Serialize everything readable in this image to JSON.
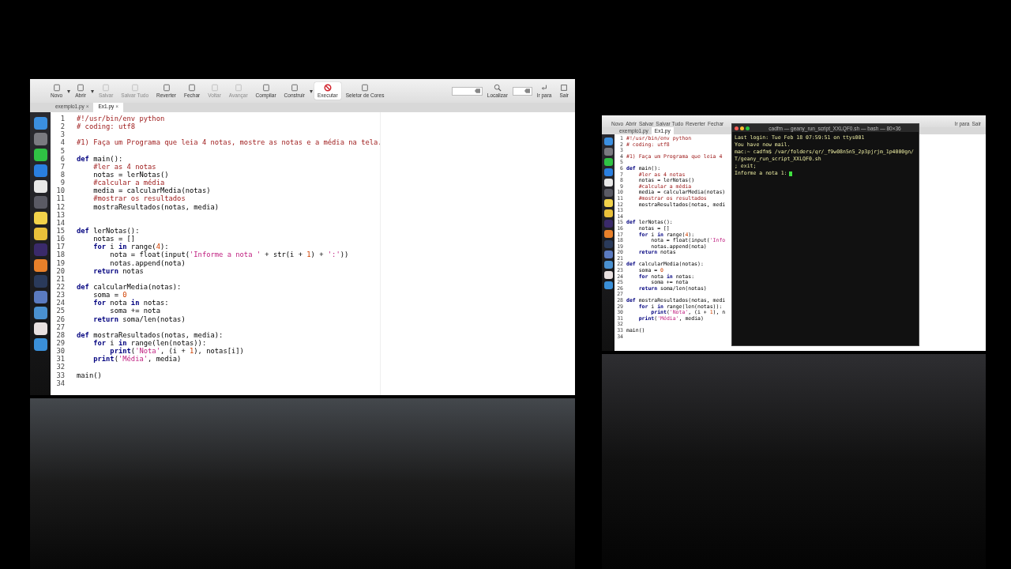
{
  "editor": {
    "toolbar": [
      {
        "label": "Novo",
        "disabled": false,
        "pressed": false,
        "caret": "▾"
      },
      {
        "label": "Abrir",
        "disabled": false,
        "pressed": false,
        "caret": "▾"
      },
      {
        "label": "Salvar",
        "disabled": true,
        "pressed": false
      },
      {
        "label": "Salvar Tudo",
        "disabled": true,
        "pressed": false
      },
      {
        "label": "Reverter",
        "disabled": false,
        "pressed": false
      },
      {
        "label": "Fechar",
        "disabled": false,
        "pressed": false
      },
      {
        "label": "Voltar",
        "disabled": true,
        "pressed": false
      },
      {
        "label": "Avançar",
        "disabled": true,
        "pressed": false
      },
      {
        "label": "Compilar",
        "disabled": false,
        "pressed": false
      },
      {
        "label": "Construir",
        "disabled": false,
        "pressed": false,
        "caret": "▾"
      },
      {
        "label": "Executar",
        "disabled": false,
        "pressed": true
      },
      {
        "label": "Seletor de Cores",
        "disabled": false,
        "pressed": false
      }
    ],
    "search_button": "Localizar",
    "goto_button": "Ir para",
    "quit_button": "Sair",
    "tabs": [
      {
        "label": "exemplo1.py",
        "selected": false
      },
      {
        "label": "Ex1.py",
        "selected": true
      }
    ],
    "close_mark": "×",
    "lines": [
      {
        "n": "1",
        "parts": [
          {
            "kind": "comment",
            "text": "#!/usr/bin/env python"
          }
        ]
      },
      {
        "n": "2",
        "parts": [
          {
            "kind": "comment",
            "text": "# coding: utf8"
          }
        ]
      },
      {
        "n": "3"
      },
      {
        "n": "4",
        "parts": [
          {
            "kind": "comment",
            "text": "#1) Faça um Programa que leia 4 notas, mostre as notas e a média na tela."
          }
        ]
      },
      {
        "n": "5"
      },
      {
        "n": "6",
        "parts": [
          {
            "kind": "keyword",
            "text": "def"
          },
          {
            "kind": "plain",
            "text": " main():"
          }
        ]
      },
      {
        "n": "7",
        "parts": [
          {
            "kind": "comment",
            "text": "    #ler as 4 notas"
          }
        ]
      },
      {
        "n": "8",
        "parts": [
          {
            "kind": "plain",
            "text": "    notas = lerNotas()"
          }
        ]
      },
      {
        "n": "9",
        "parts": [
          {
            "kind": "comment",
            "text": "    #calcular a média"
          }
        ]
      },
      {
        "n": "10",
        "parts": [
          {
            "kind": "plain",
            "text": "    media = calcularMedia(notas)"
          }
        ]
      },
      {
        "n": "11",
        "parts": [
          {
            "kind": "comment",
            "text": "    #mostrar os resultados"
          }
        ]
      },
      {
        "n": "12",
        "parts": [
          {
            "kind": "plain",
            "text": "    mostraResultados(notas, media)"
          }
        ]
      },
      {
        "n": "13"
      },
      {
        "n": "14"
      },
      {
        "n": "15",
        "parts": [
          {
            "kind": "keyword",
            "text": "def"
          },
          {
            "kind": "plain",
            "text": " lerNotas():"
          }
        ]
      },
      {
        "n": "16",
        "parts": [
          {
            "kind": "plain",
            "text": "    notas = []"
          }
        ]
      },
      {
        "n": "17",
        "parts": [
          {
            "kind": "keyword",
            "text": "    for"
          },
          {
            "kind": "plain",
            "text": " i "
          },
          {
            "kind": "keyword",
            "text": "in"
          },
          {
            "kind": "plain",
            "text": " range("
          },
          {
            "kind": "number",
            "text": "4"
          },
          {
            "kind": "plain",
            "text": "):"
          }
        ]
      },
      {
        "n": "18",
        "parts": [
          {
            "kind": "plain",
            "text": "        nota = float(input("
          },
          {
            "kind": "string",
            "text": "'Informe a nota '"
          },
          {
            "kind": "plain",
            "text": " + str(i + "
          },
          {
            "kind": "number",
            "text": "1"
          },
          {
            "kind": "plain",
            "text": ") + "
          },
          {
            "kind": "string",
            "text": "':'"
          },
          {
            "kind": "plain",
            "text": "))"
          }
        ]
      },
      {
        "n": "19",
        "parts": [
          {
            "kind": "plain",
            "text": "        notas.append(nota)"
          }
        ]
      },
      {
        "n": "20",
        "parts": [
          {
            "kind": "keyword",
            "text": "    return"
          },
          {
            "kind": "plain",
            "text": " notas"
          }
        ]
      },
      {
        "n": "21"
      },
      {
        "n": "22",
        "parts": [
          {
            "kind": "keyword",
            "text": "def"
          },
          {
            "kind": "plain",
            "text": " calcularMedia(notas):"
          }
        ]
      },
      {
        "n": "23",
        "parts": [
          {
            "kind": "plain",
            "text": "    soma = "
          },
          {
            "kind": "number",
            "text": "0"
          }
        ]
      },
      {
        "n": "24",
        "parts": [
          {
            "kind": "keyword",
            "text": "    for"
          },
          {
            "kind": "plain",
            "text": " nota "
          },
          {
            "kind": "keyword",
            "text": "in"
          },
          {
            "kind": "plain",
            "text": " notas:"
          }
        ]
      },
      {
        "n": "25",
        "parts": [
          {
            "kind": "plain",
            "text": "        soma += nota"
          }
        ]
      },
      {
        "n": "26",
        "parts": [
          {
            "kind": "keyword",
            "text": "    return"
          },
          {
            "kind": "plain",
            "text": " soma/len(notas)"
          }
        ]
      },
      {
        "n": "27"
      },
      {
        "n": "28",
        "parts": [
          {
            "kind": "keyword",
            "text": "def"
          },
          {
            "kind": "plain",
            "text": " mostraResultados(notas, media):"
          }
        ]
      },
      {
        "n": "29",
        "parts": [
          {
            "kind": "keyword",
            "text": "    for"
          },
          {
            "kind": "plain",
            "text": " i "
          },
          {
            "kind": "keyword",
            "text": "in"
          },
          {
            "kind": "plain",
            "text": " range(len(notas)):"
          }
        ]
      },
      {
        "n": "30",
        "parts": [
          {
            "kind": "keyword",
            "text": "        print"
          },
          {
            "kind": "plain",
            "text": "("
          },
          {
            "kind": "string",
            "text": "'Nota'"
          },
          {
            "kind": "plain",
            "text": ", (i + "
          },
          {
            "kind": "number",
            "text": "1"
          },
          {
            "kind": "plain",
            "text": "), notas[i])"
          }
        ]
      },
      {
        "n": "31",
        "parts": [
          {
            "kind": "keyword",
            "text": "    print"
          },
          {
            "kind": "plain",
            "text": "("
          },
          {
            "kind": "string",
            "text": "'Média'"
          },
          {
            "kind": "plain",
            "text": ", media)"
          }
        ]
      },
      {
        "n": "32"
      },
      {
        "n": "33",
        "parts": [
          {
            "kind": "plain",
            "text": "main()"
          }
        ]
      },
      {
        "n": "34"
      }
    ]
  },
  "second_desktop": {
    "toolbar": [
      "Novo",
      "Abrir",
      "Salvar",
      "Salvar Tudo",
      "Reverter",
      "Fechar"
    ],
    "goto_button": "Ir para",
    "quit_button": "Sair",
    "tabs": [
      {
        "label": "exemplo1.py",
        "selected": false
      },
      {
        "label": "Ex1.py",
        "selected": true
      }
    ],
    "lines": [
      {
        "n": "1",
        "parts": [
          {
            "kind": "comment",
            "text": "#!/usr/bin/env python"
          }
        ]
      },
      {
        "n": "2",
        "parts": [
          {
            "kind": "comment",
            "text": "# coding: utf8"
          }
        ]
      },
      {
        "n": "3"
      },
      {
        "n": "4",
        "parts": [
          {
            "kind": "comment",
            "text": "#1) Faça um Programa que leia 4"
          }
        ]
      },
      {
        "n": "5"
      },
      {
        "n": "6",
        "parts": [
          {
            "kind": "keyword",
            "text": "def"
          },
          {
            "kind": "plain",
            "text": " main():"
          }
        ]
      },
      {
        "n": "7",
        "parts": [
          {
            "kind": "comment",
            "text": "    #ler as 4 notas"
          }
        ]
      },
      {
        "n": "8",
        "parts": [
          {
            "kind": "plain",
            "text": "    notas = lerNotas()"
          }
        ]
      },
      {
        "n": "9",
        "parts": [
          {
            "kind": "comment",
            "text": "    #calcular a média"
          }
        ]
      },
      {
        "n": "10",
        "parts": [
          {
            "kind": "plain",
            "text": "    media = calcularMedia(notas)"
          }
        ]
      },
      {
        "n": "11",
        "parts": [
          {
            "kind": "comment",
            "text": "    #mostrar os resultados"
          }
        ]
      },
      {
        "n": "12",
        "parts": [
          {
            "kind": "plain",
            "text": "    mostraResultados(notas, medi"
          }
        ]
      },
      {
        "n": "13"
      },
      {
        "n": "14"
      },
      {
        "n": "15",
        "parts": [
          {
            "kind": "keyword",
            "text": "def"
          },
          {
            "kind": "plain",
            "text": " lerNotas():"
          }
        ]
      },
      {
        "n": "16",
        "parts": [
          {
            "kind": "plain",
            "text": "    notas = []"
          }
        ]
      },
      {
        "n": "17",
        "parts": [
          {
            "kind": "keyword",
            "text": "    for"
          },
          {
            "kind": "plain",
            "text": " i "
          },
          {
            "kind": "keyword",
            "text": "in"
          },
          {
            "kind": "plain",
            "text": " range("
          },
          {
            "kind": "number",
            "text": "4"
          },
          {
            "kind": "plain",
            "text": "):"
          }
        ]
      },
      {
        "n": "18",
        "parts": [
          {
            "kind": "plain",
            "text": "        nota = float(input("
          },
          {
            "kind": "string",
            "text": "'Info"
          }
        ]
      },
      {
        "n": "19",
        "parts": [
          {
            "kind": "plain",
            "text": "        notas.append(nota)"
          }
        ]
      },
      {
        "n": "20",
        "parts": [
          {
            "kind": "keyword",
            "text": "    return"
          },
          {
            "kind": "plain",
            "text": " notas"
          }
        ]
      },
      {
        "n": "21"
      },
      {
        "n": "22",
        "parts": [
          {
            "kind": "keyword",
            "text": "def"
          },
          {
            "kind": "plain",
            "text": " calcularMedia(notas):"
          }
        ]
      },
      {
        "n": "23",
        "parts": [
          {
            "kind": "plain",
            "text": "    soma = "
          },
          {
            "kind": "number",
            "text": "0"
          }
        ]
      },
      {
        "n": "24",
        "parts": [
          {
            "kind": "keyword",
            "text": "    for"
          },
          {
            "kind": "plain",
            "text": " nota "
          },
          {
            "kind": "keyword",
            "text": "in"
          },
          {
            "kind": "plain",
            "text": " notas:"
          }
        ]
      },
      {
        "n": "25",
        "parts": [
          {
            "kind": "plain",
            "text": "        soma += nota"
          }
        ]
      },
      {
        "n": "26",
        "parts": [
          {
            "kind": "keyword",
            "text": "    return"
          },
          {
            "kind": "plain",
            "text": " soma/len(notas)"
          }
        ]
      },
      {
        "n": "27"
      },
      {
        "n": "28",
        "parts": [
          {
            "kind": "keyword",
            "text": "def"
          },
          {
            "kind": "plain",
            "text": " mostraResultados(notas, medi"
          }
        ]
      },
      {
        "n": "29",
        "parts": [
          {
            "kind": "keyword",
            "text": "    for"
          },
          {
            "kind": "plain",
            "text": " i "
          },
          {
            "kind": "keyword",
            "text": "in"
          },
          {
            "kind": "plain",
            "text": " range(len(notas)):"
          }
        ]
      },
      {
        "n": "30",
        "parts": [
          {
            "kind": "keyword",
            "text": "        print"
          },
          {
            "kind": "plain",
            "text": "("
          },
          {
            "kind": "string",
            "text": "'Nota'"
          },
          {
            "kind": "plain",
            "text": ", (i + "
          },
          {
            "kind": "number",
            "text": "1"
          },
          {
            "kind": "plain",
            "text": "), n"
          }
        ]
      },
      {
        "n": "31",
        "parts": [
          {
            "kind": "keyword",
            "text": "    print"
          },
          {
            "kind": "plain",
            "text": "("
          },
          {
            "kind": "string",
            "text": "'Média'"
          },
          {
            "kind": "plain",
            "text": ", media)"
          }
        ]
      },
      {
        "n": "32"
      },
      {
        "n": "33",
        "parts": [
          {
            "kind": "plain",
            "text": "main()"
          }
        ]
      },
      {
        "n": "34"
      }
    ],
    "terminal": {
      "title": "cadfm — geany_run_script_XXLQF0.sh — bash — 80×36",
      "lines": [
        "Last login: Tue Feb 18 07:59:51 on ttys001",
        "You have new mail.",
        "mac:~ cadfm$ /var/folders/qr/_f9w08n5n5_2p3pjrjm_1p4000gn/T/geany_run_script_XXLQF0.sh",
        "; exit;",
        "Informe a nota 1:"
      ]
    }
  }
}
